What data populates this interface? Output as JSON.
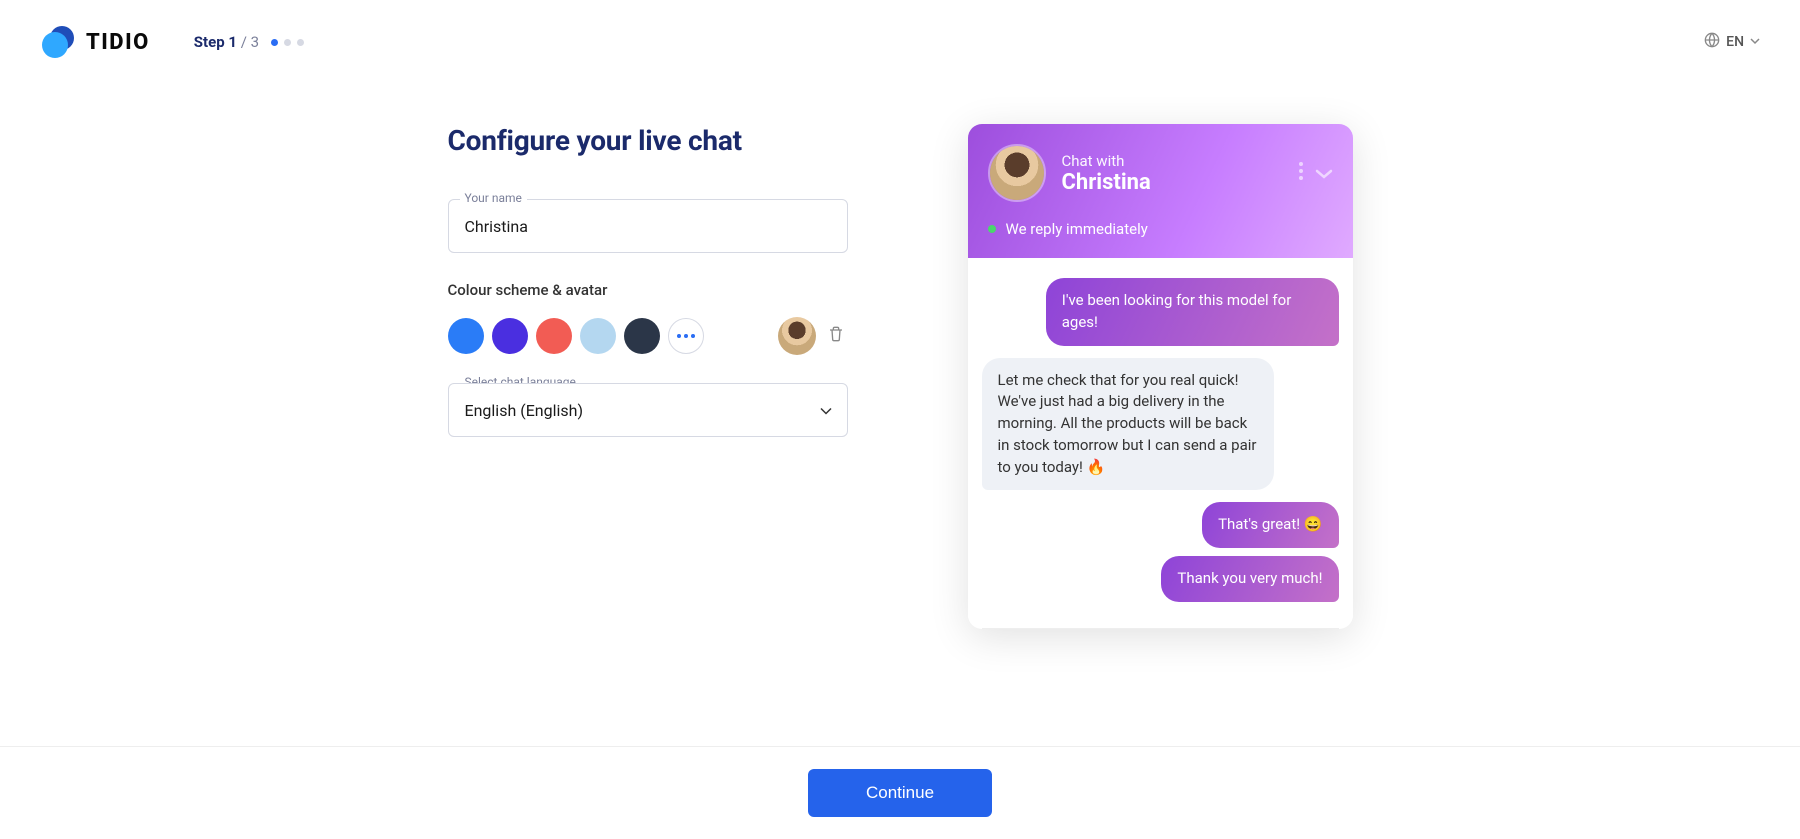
{
  "logo": {
    "text": "TIDIO"
  },
  "step": {
    "label_strong": "Step 1",
    "label_total": "/ 3",
    "current": 1,
    "total": 3
  },
  "lang": {
    "code": "EN"
  },
  "title": "Configure your live chat",
  "name_field": {
    "label": "Your name",
    "value": "Christina"
  },
  "color_section": {
    "label": "Colour scheme & avatar"
  },
  "colors": [
    "#2a7cf7",
    "#4a2fe0",
    "#f25c54",
    "#b4d7f0",
    "#2b3648"
  ],
  "lang_field": {
    "label": "Select chat language",
    "value": "English (English)"
  },
  "chat": {
    "pre": "Chat with",
    "name": "Christina",
    "reply": "We reply immediately",
    "messages": [
      {
        "side": "them",
        "text": "I've been looking for this model for ages!"
      },
      {
        "side": "me",
        "text": "Let me check that for you real quick! We've just had a big delivery in the morning. All the products will be back in stock tomorrow but I can send a pair to you today! 🔥"
      },
      {
        "side": "them",
        "text": "That's great! 😄"
      },
      {
        "side": "them",
        "text": "Thank you very much!"
      }
    ]
  },
  "continue": "Continue"
}
